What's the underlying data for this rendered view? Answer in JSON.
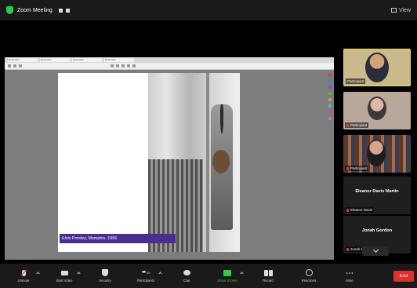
{
  "topbar": {
    "title": "Zoom Meeting",
    "view_label": "View"
  },
  "share": {
    "tabs": [
      "Document",
      "Document",
      "Document",
      "Document"
    ],
    "caption": "Elvis Presley, Memphis, 1956"
  },
  "gallery": {
    "tiles": [
      {
        "name": "Participant"
      },
      {
        "name": "Participant"
      },
      {
        "name": "Participant"
      },
      {
        "name_center": "Eleanor Davis Martin",
        "name": "Eleanor Davis"
      },
      {
        "name_center": "Jonah Gordon",
        "name": "Jonah Gordon"
      }
    ]
  },
  "toolbar": {
    "items": [
      {
        "label": "Unmute"
      },
      {
        "label": "Start Video"
      },
      {
        "label": "Security"
      },
      {
        "label": "Participants",
        "count": "25"
      },
      {
        "label": "Chat"
      },
      {
        "label": "Share Screen"
      },
      {
        "label": "Record"
      },
      {
        "label": "Reactions"
      },
      {
        "label": "More"
      }
    ],
    "end_label": "End"
  },
  "colors": {
    "share_green": "#2ecc40",
    "end_red": "#e0302e",
    "caption_purple": "#4b2c8f",
    "active_speaker": "#e9d44a"
  }
}
